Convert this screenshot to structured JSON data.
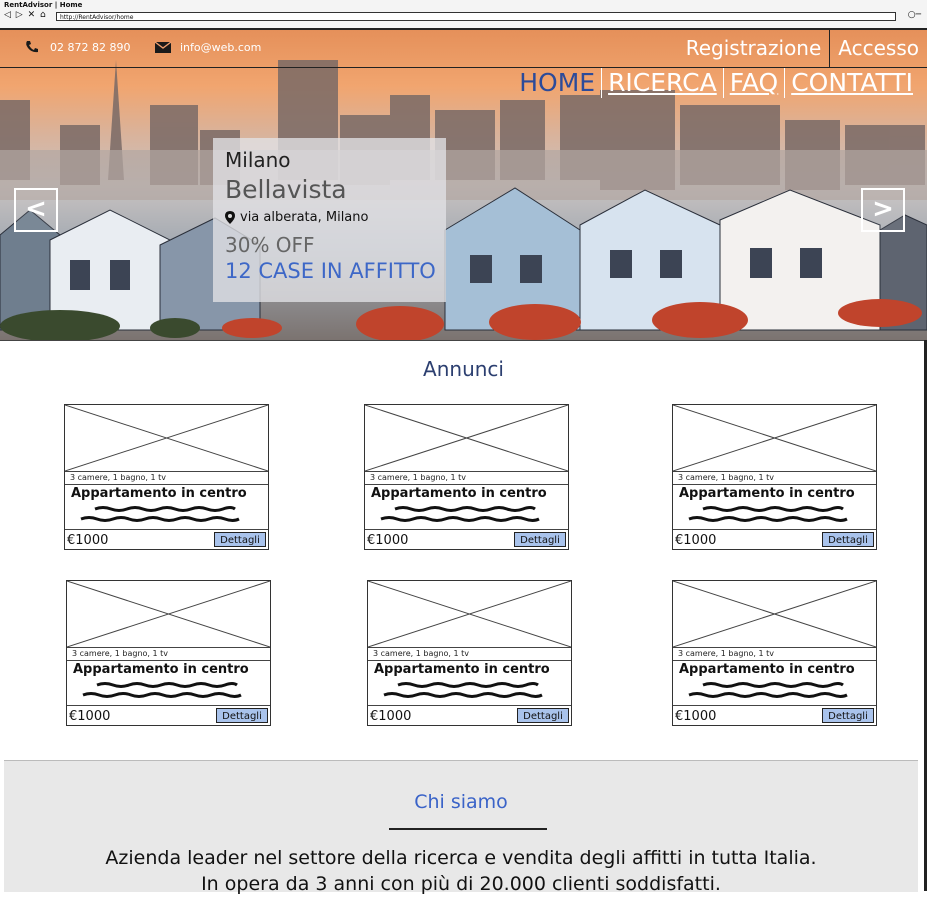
{
  "browser": {
    "title": "RentAdvisor | Home",
    "nav_glyphs": "◁ ▷ ✕ ⌂",
    "url": "http://RentAdvisor/home"
  },
  "header": {
    "phone": "02 872 82 890",
    "email": "info@web.com",
    "register_label": "Registrazione",
    "login_label": "Accesso",
    "nav": [
      {
        "label": "HOME"
      },
      {
        "label": "RICERCA"
      },
      {
        "label": "FAQ"
      },
      {
        "label": "CONTATTI"
      }
    ]
  },
  "hero": {
    "city": "Milano",
    "name": "Bellavista",
    "address": "via alberata, Milano",
    "discount": "30% OFF",
    "count": "12 CASE IN AFFITTO",
    "prev_glyph": "<",
    "next_glyph": ">"
  },
  "listings": {
    "title": "Annunci",
    "cards": [
      {
        "features": "3 camere, 1 bagno, 1 tv",
        "title": "Appartamento in centro",
        "price": "€1000",
        "button": "Dettagli"
      },
      {
        "features": "3 camere, 1 bagno, 1 tv",
        "title": "Appartamento in centro",
        "price": "€1000",
        "button": "Dettagli"
      },
      {
        "features": "3 camere, 1 bagno, 1 tv",
        "title": "Appartamento in centro",
        "price": "€1000",
        "button": "Dettagli"
      },
      {
        "features": "3 camere, 1 bagno, 1 tv",
        "title": "Appartamento in centro",
        "price": "€1000",
        "button": "Dettagli"
      },
      {
        "features": "3 camere, 1 bagno, 1 tv",
        "title": "Appartamento in centro",
        "price": "€1000",
        "button": "Dettagli"
      },
      {
        "features": "3 camere, 1 bagno, 1 tv",
        "title": "Appartamento in centro",
        "price": "€1000",
        "button": "Dettagli"
      }
    ]
  },
  "about": {
    "title": "Chi siamo",
    "line1": "Azienda leader nel settore della ricerca e vendita degli affitti in tutta Italia.",
    "line2": "In opera da 3 anni con più di 20.000 clienti soddisfatti."
  },
  "colors": {
    "nav_active": "#2c4b9a",
    "count_link": "#3d67c7",
    "button_bg": "#a9c3ec",
    "about_title": "#3a63c8"
  }
}
